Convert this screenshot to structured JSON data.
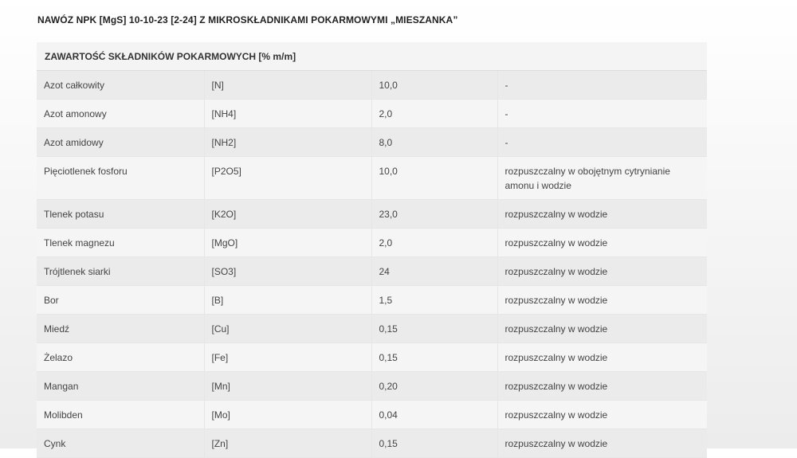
{
  "page": {
    "title": "NAWÓZ NPK [MgS] 10-10-23 [2-24] Z MIKROSKŁADNIKAMI POKARMOWYMI „MIESZANKA”"
  },
  "table": {
    "header": "ZAWARTOŚĆ SKŁADNIKÓW POKARMOWYCH [% m/m]",
    "rows": [
      {
        "name": "Azot całkowity",
        "formula": "[N]",
        "value": "10,0",
        "note": "-"
      },
      {
        "name": "Azot amonowy",
        "formula": "[NH4]",
        "value": "2,0",
        "note": "-"
      },
      {
        "name": "Azot amidowy",
        "formula": "[NH2]",
        "value": "8,0",
        "note": "-"
      },
      {
        "name": "Pięciotlenek fosforu",
        "formula": "[P2O5]",
        "value": "10,0",
        "note": "rozpuszczalny w obojętnym cytrynianie amonu i wodzie"
      },
      {
        "name": "Tlenek potasu",
        "formula": "[K2O]",
        "value": "23,0",
        "note": "rozpuszczalny w wodzie"
      },
      {
        "name": "Tlenek magnezu",
        "formula": "[MgO]",
        "value": "2,0",
        "note": "rozpuszczalny w wodzie"
      },
      {
        "name": "Trójtlenek siarki",
        "formula": "[SO3]",
        "value": "24",
        "note": "rozpuszczalny w wodzie"
      },
      {
        "name": "Bor",
        "formula": "[B]",
        "value": "1,5",
        "note": "rozpuszczalny w wodzie"
      },
      {
        "name": "Miedź",
        "formula": "[Cu]",
        "value": "0,15",
        "note": "rozpuszczalny w wodzie"
      },
      {
        "name": "Żelazo",
        "formula": "[Fe]",
        "value": "0,15",
        "note": "rozpuszczalny w wodzie"
      },
      {
        "name": "Mangan",
        "formula": "[Mn]",
        "value": "0,20",
        "note": "rozpuszczalny w wodzie"
      },
      {
        "name": "Molibden",
        "formula": "[Mo]",
        "value": "0,04",
        "note": "rozpuszczalny w wodzie"
      },
      {
        "name": "Cynk",
        "formula": "[Zn]",
        "value": "0,15",
        "note": "rozpuszczalny w wodzie"
      }
    ]
  }
}
